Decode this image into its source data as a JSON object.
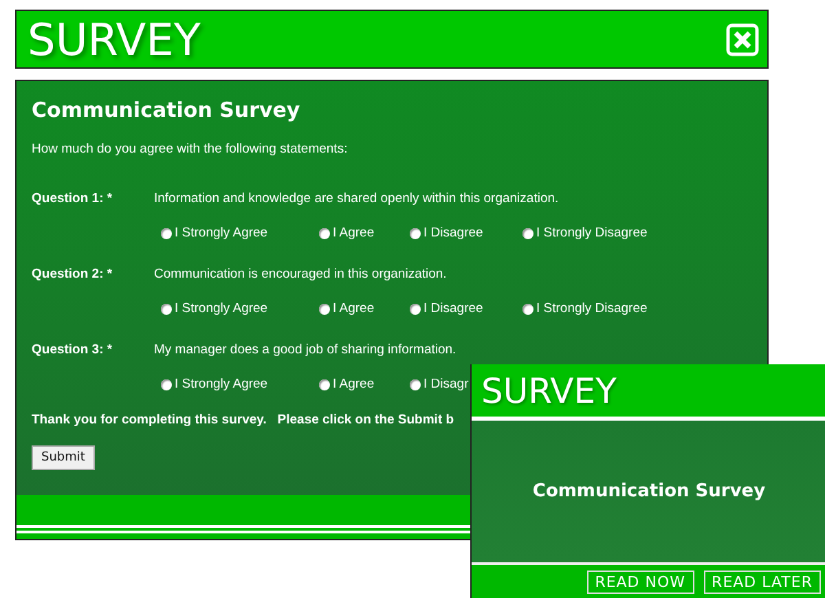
{
  "window": {
    "title": "SURVEY"
  },
  "survey": {
    "title": "Communication Survey",
    "instruction": "How much do you agree with the following statements:",
    "questions": [
      {
        "label": "Question 1: *",
        "text": "Information and knowledge are shared openly within this organization.",
        "options": [
          {
            "label": "I Strongly Agree",
            "selected": false
          },
          {
            "label": "I Agree",
            "selected": false
          },
          {
            "label": "I Disagree",
            "selected": false
          },
          {
            "label": "I Strongly Disagree",
            "selected": false
          }
        ]
      },
      {
        "label": "Question 2: *",
        "text": "Communication is encouraged in this organization.",
        "options": [
          {
            "label": "I Strongly Agree",
            "selected": false
          },
          {
            "label": "I Agree",
            "selected": false
          },
          {
            "label": "I Disagree",
            "selected": false
          },
          {
            "label": "I Strongly Disagree",
            "selected": false
          }
        ]
      },
      {
        "label": "Question 3: *",
        "text": "My manager does a good job of sharing information.",
        "options": [
          {
            "label": "I Strongly Agree",
            "selected": false
          },
          {
            "label": "I Agree",
            "selected": false
          },
          {
            "label": "I Disagr",
            "selected": false
          }
        ]
      }
    ],
    "thanks": "Thank you for completing this survey.   Please click on the Submit b",
    "submit": "Submit"
  },
  "popup": {
    "title": "SURVEY",
    "heading": "Communication Survey",
    "buttons": [
      "READ NOW",
      "READ LATER"
    ]
  }
}
